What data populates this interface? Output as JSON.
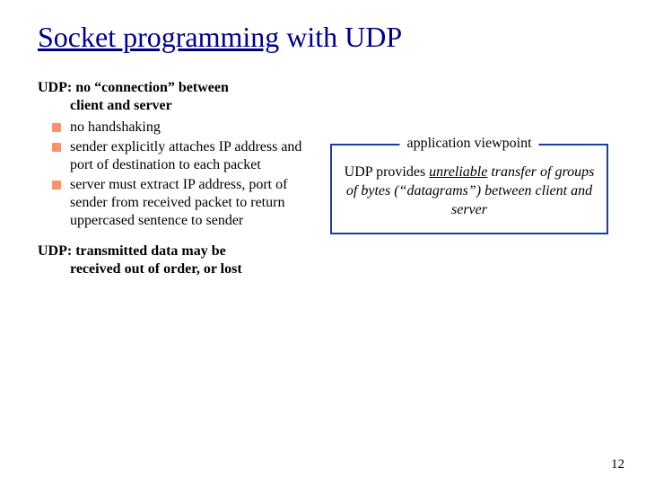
{
  "title": {
    "underlined": "Socket programming",
    "rest": " with UDP"
  },
  "left": {
    "heading1_line1": "UDP: no “connection” between",
    "heading1_line2": "client and server",
    "bullets": [
      "no handshaking",
      "sender explicitly attaches IP address and port of destination to each packet",
      "server must extract IP address, port of sender from received packet to return uppercased sentence to sender"
    ],
    "heading2_line1": "UDP: transmitted data may be",
    "heading2_line2": "received out of order, or lost"
  },
  "box": {
    "legend": "application viewpoint",
    "line_pre": "UDP provides ",
    "line_mid": "unreliable",
    "line_post": " transfer of groups of bytes (“datagrams”) between client and server"
  },
  "page_number": "12"
}
